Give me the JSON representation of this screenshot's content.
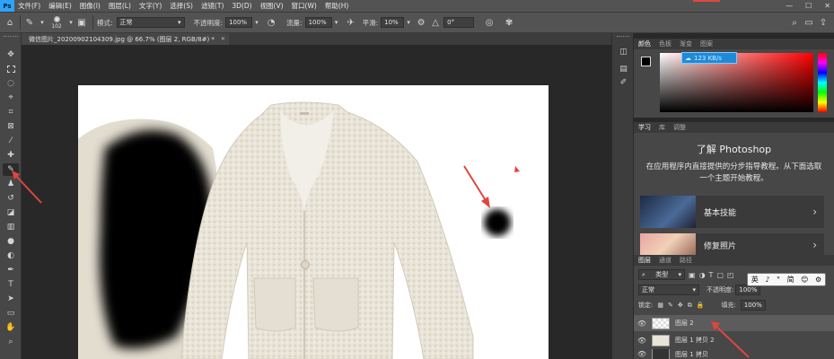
{
  "menubar": {
    "logo": "Ps",
    "items": [
      "文件(F)",
      "编辑(E)",
      "图像(I)",
      "图层(L)",
      "文字(Y)",
      "选择(S)",
      "滤镜(T)",
      "3D(D)",
      "视图(V)",
      "窗口(W)",
      "帮助(H)"
    ],
    "controls": [
      "—",
      "☐",
      "✕"
    ]
  },
  "options": {
    "brush_size": "102",
    "mode_label": "模式:",
    "mode_value": "正常",
    "opacity_label": "不透明度:",
    "opacity_value": "100%",
    "flow_label": "流量:",
    "flow_value": "100%",
    "smooth_label": "平滑:",
    "smooth_value": "10%",
    "angle_value": "0°"
  },
  "document": {
    "tab_title": "微信图片_20200902104309.jpg @ 66.7% (图层 2, RGB/8#) *",
    "close": "✕"
  },
  "color_panel": {
    "tabs": [
      "颜色",
      "色板",
      "渐变",
      "图案"
    ],
    "badge_text": "123 KB/s"
  },
  "learn_panel": {
    "tabs": [
      "学习",
      "库",
      "调整"
    ],
    "title": "了解 Photoshop",
    "description": "在应用程序内直接提供的分步指导教程。从下面选取一个主题开始教程。",
    "cards": [
      {
        "label": "基本技能",
        "arrow": "›"
      },
      {
        "label": "修复照片",
        "arrow": "›"
      }
    ]
  },
  "layers_panel": {
    "tabs": [
      "图层",
      "通道",
      "路径"
    ],
    "kind_label": "类型",
    "blend_mode": "正常",
    "opacity_label": "不透明度:",
    "opacity_value": "100%",
    "lock_label": "锁定:",
    "fill_label": "填充:",
    "fill_value": "100%",
    "layers": [
      {
        "name": "图层 2"
      },
      {
        "name": "图层 1 拷贝 2"
      },
      {
        "name": "图层 1 拷贝"
      }
    ]
  },
  "ime_bar": {
    "items": [
      "英",
      "♪",
      "°",
      "简",
      "😊",
      "⚙"
    ]
  },
  "colors": {
    "accent_blue": "#1f8ad8",
    "annotation_red": "#e0463d",
    "panel": "#474747",
    "canvas_bg": "#282828"
  }
}
